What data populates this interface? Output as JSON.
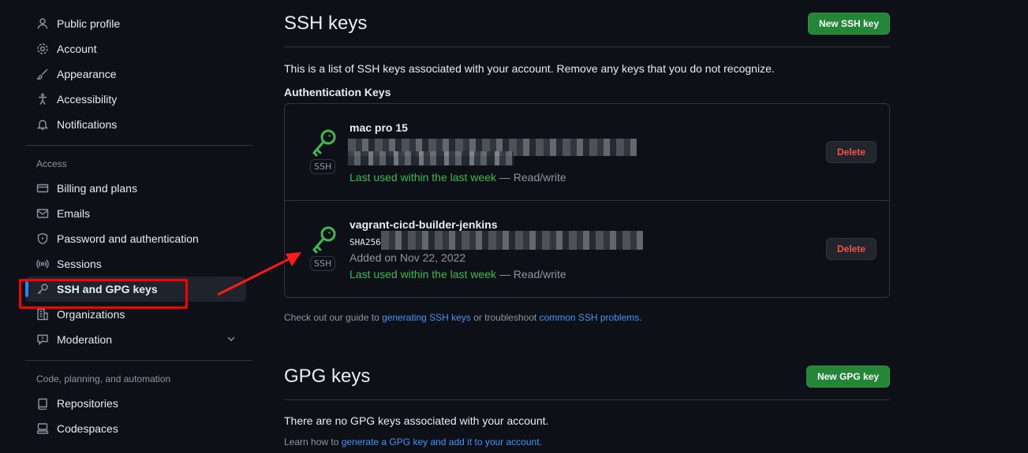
{
  "sidebar": {
    "top_items": [
      {
        "label": "Public profile",
        "icon": "person-icon"
      },
      {
        "label": "Account",
        "icon": "gear-icon"
      },
      {
        "label": "Appearance",
        "icon": "paintbrush-icon"
      },
      {
        "label": "Accessibility",
        "icon": "accessibility-icon"
      },
      {
        "label": "Notifications",
        "icon": "bell-icon"
      }
    ],
    "access_title": "Access",
    "access_items": [
      {
        "label": "Billing and plans",
        "icon": "credit-card-icon"
      },
      {
        "label": "Emails",
        "icon": "mail-icon"
      },
      {
        "label": "Password and authentication",
        "icon": "shield-lock-icon"
      },
      {
        "label": "Sessions",
        "icon": "broadcast-icon"
      },
      {
        "label": "SSH and GPG keys",
        "icon": "key-icon",
        "active": true
      },
      {
        "label": "Organizations",
        "icon": "organization-icon"
      },
      {
        "label": "Moderation",
        "icon": "report-icon"
      }
    ],
    "code_title": "Code, planning, and automation",
    "code_items": [
      {
        "label": "Repositories",
        "icon": "repo-icon"
      },
      {
        "label": "Codespaces",
        "icon": "codespaces-icon"
      }
    ]
  },
  "ssh": {
    "title": "SSH keys",
    "new_button": "New SSH key",
    "description": "This is a list of SSH keys associated with your account. Remove any keys that you do not recognize.",
    "auth_title": "Authentication Keys",
    "keys": [
      {
        "title": "mac pro 15",
        "badge": "SSH",
        "last_used": "Last used within the last week",
        "access": " — Read/write",
        "delete": "Delete"
      },
      {
        "title": "vagrant-cicd-builder-jenkins",
        "badge": "SSH",
        "fingerprint_prefix": "SHA256",
        "added": "Added on Nov 22, 2022",
        "last_used": "Last used within the last week",
        "access": " — Read/write",
        "delete": "Delete"
      }
    ],
    "guide_prefix": "Check out our guide to ",
    "guide_link1": "generating SSH keys",
    "guide_middle": " or troubleshoot ",
    "guide_link2": "common SSH problems",
    "guide_suffix": "."
  },
  "gpg": {
    "title": "GPG keys",
    "new_button": "New GPG key",
    "empty": "There are no GPG keys associated with your account.",
    "learn_prefix": "Learn how to ",
    "learn_link": "generate a GPG key and add it to your account",
    "learn_suffix": "."
  },
  "colors": {
    "accent_green": "#238636",
    "danger": "#f85149",
    "link": "#4493f8",
    "highlight": "#ff0000"
  }
}
